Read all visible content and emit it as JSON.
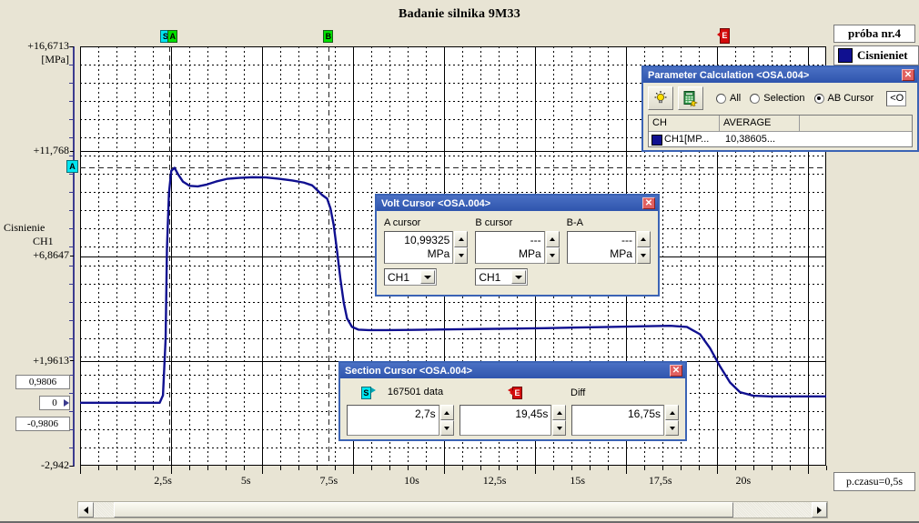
{
  "chart_data": {
    "type": "line",
    "title": "Badanie silnika 9M33",
    "xlabel": "",
    "ylabel": "Cisnienie CH1",
    "yunit": "[MPa]",
    "xunit": "s",
    "ylim": [
      -2.942,
      16.6713
    ],
    "xlim": [
      0.0,
      22.5
    ],
    "grid": true,
    "legend_position": "top-right",
    "series": [
      {
        "name": "Cisnienie",
        "color": "#101090",
        "x": [
          0.0,
          0.5,
          1.0,
          1.5,
          2.0,
          2.4,
          2.5,
          2.58,
          2.62,
          2.68,
          2.75,
          2.85,
          2.95,
          3.1,
          3.3,
          3.55,
          3.8,
          4.1,
          4.45,
          4.8,
          5.2,
          5.6,
          6.0,
          6.4,
          6.75,
          7.0,
          7.15,
          7.3,
          7.45,
          7.55,
          7.65,
          7.75,
          7.85,
          7.95,
          8.05,
          8.2,
          8.4,
          8.7,
          9.2,
          10.0,
          11.0,
          12.0,
          13.0,
          14.0,
          15.0,
          16.0,
          17.0,
          17.8,
          18.3,
          18.7,
          19.0,
          19.3,
          19.6,
          19.9,
          20.3,
          20.8,
          21.4,
          22.0,
          22.5
        ],
        "y": [
          0.0,
          0.0,
          0.0,
          0.0,
          0.0,
          0.0,
          0.35,
          3.0,
          7.2,
          9.8,
          10.85,
          10.99,
          10.7,
          10.35,
          10.15,
          10.12,
          10.2,
          10.35,
          10.48,
          10.52,
          10.55,
          10.54,
          10.48,
          10.4,
          10.3,
          10.17,
          9.95,
          9.72,
          9.55,
          9.1,
          8.3,
          7.1,
          5.8,
          4.7,
          3.95,
          3.55,
          3.42,
          3.4,
          3.4,
          3.41,
          3.43,
          3.45,
          3.47,
          3.49,
          3.52,
          3.55,
          3.58,
          3.6,
          3.55,
          3.2,
          2.55,
          1.7,
          0.95,
          0.5,
          0.33,
          0.3,
          0.3,
          0.3,
          0.3
        ]
      }
    ],
    "y_ticks": [
      {
        "value": 16.6713,
        "label": "+16,6713"
      },
      {
        "value": 11.768,
        "label": "+11,768"
      },
      {
        "value": 6.8647,
        "label": "+6,8647"
      },
      {
        "value": 1.9613,
        "label": "+1,9613"
      },
      {
        "value": -2.942,
        "label": "-2,942"
      }
    ],
    "y_value_boxes": [
      {
        "value": 0.9806,
        "label": "0,9806"
      },
      {
        "value": 0.0,
        "label": "0"
      },
      {
        "value": -0.9806,
        "label": "-0,9806"
      }
    ],
    "x_ticks": [
      {
        "value": 2.5,
        "label": "2,5s"
      },
      {
        "value": 5.0,
        "label": "5s"
      },
      {
        "value": 7.5,
        "label": "7,5s"
      },
      {
        "value": 10.0,
        "label": "10s"
      },
      {
        "value": 12.5,
        "label": "12,5s"
      },
      {
        "value": 15.0,
        "label": "15s"
      },
      {
        "value": 17.5,
        "label": "17,5s"
      },
      {
        "value": 20.0,
        "label": "20s"
      }
    ],
    "cursors": [
      {
        "name": "S",
        "label": "S",
        "type": "section-start",
        "color": "#00e5f0",
        "x": 2.7
      },
      {
        "name": "A",
        "label": "A",
        "type": "volt-a",
        "color": "#00e000",
        "x": 2.75,
        "y": 10.99325
      },
      {
        "name": "B",
        "label": "B",
        "type": "volt-b",
        "color": "#00e000",
        "x": 7.5
      },
      {
        "name": "E",
        "label": "E",
        "type": "section-end",
        "color": "#d30b0b",
        "x": 19.45
      }
    ]
  },
  "plot": {
    "axis_unit": "[MPa]",
    "axis_name_line1": "Cisnienie",
    "axis_name_line2": "CH1",
    "proba_label": "próba nr.4",
    "legend_label": "Cisnieniet",
    "time_per_div_label": "p.czasu=0,5s"
  },
  "param_dialog": {
    "title": "Parameter Calculation <OSA.004>",
    "close_label": "✕",
    "buttons": {
      "hint_icon": "lightbulb-icon",
      "calc_icon": "calculator-icon"
    },
    "radios": [
      {
        "label": "All",
        "selected": false
      },
      {
        "label": "Selection",
        "selected": false
      },
      {
        "label": "AB Cursor",
        "selected": true
      }
    ],
    "extra_field": "<O",
    "table": {
      "headers": [
        "CH",
        "AVERAGE",
        ""
      ],
      "rows": [
        {
          "ch": "CH1[MP...",
          "average": "10,38605...",
          "extra": ""
        }
      ]
    }
  },
  "volt_dialog": {
    "title": "Volt Cursor <OSA.004>",
    "close_label": "✕",
    "groups": [
      {
        "label": "A cursor",
        "value": "10,99325",
        "unit": "MPa",
        "channel": "CH1"
      },
      {
        "label": "B cursor",
        "value": "---",
        "unit": "MPa",
        "channel": "CH1"
      },
      {
        "label": "B-A",
        "value": "---",
        "unit": "MPa",
        "channel": null
      }
    ]
  },
  "section_dialog": {
    "title": "Section Cursor <OSA.004>",
    "close_label": "✕",
    "start_marker": "S",
    "end_marker": "E",
    "data_count_label": "167501 data",
    "diff_label": "Diff",
    "fields": [
      {
        "value": "2,7s"
      },
      {
        "value": "19,45s"
      },
      {
        "value": "16,75s"
      }
    ]
  },
  "scrollbar": {
    "left_arrow": "◀",
    "right_arrow": "▶"
  }
}
